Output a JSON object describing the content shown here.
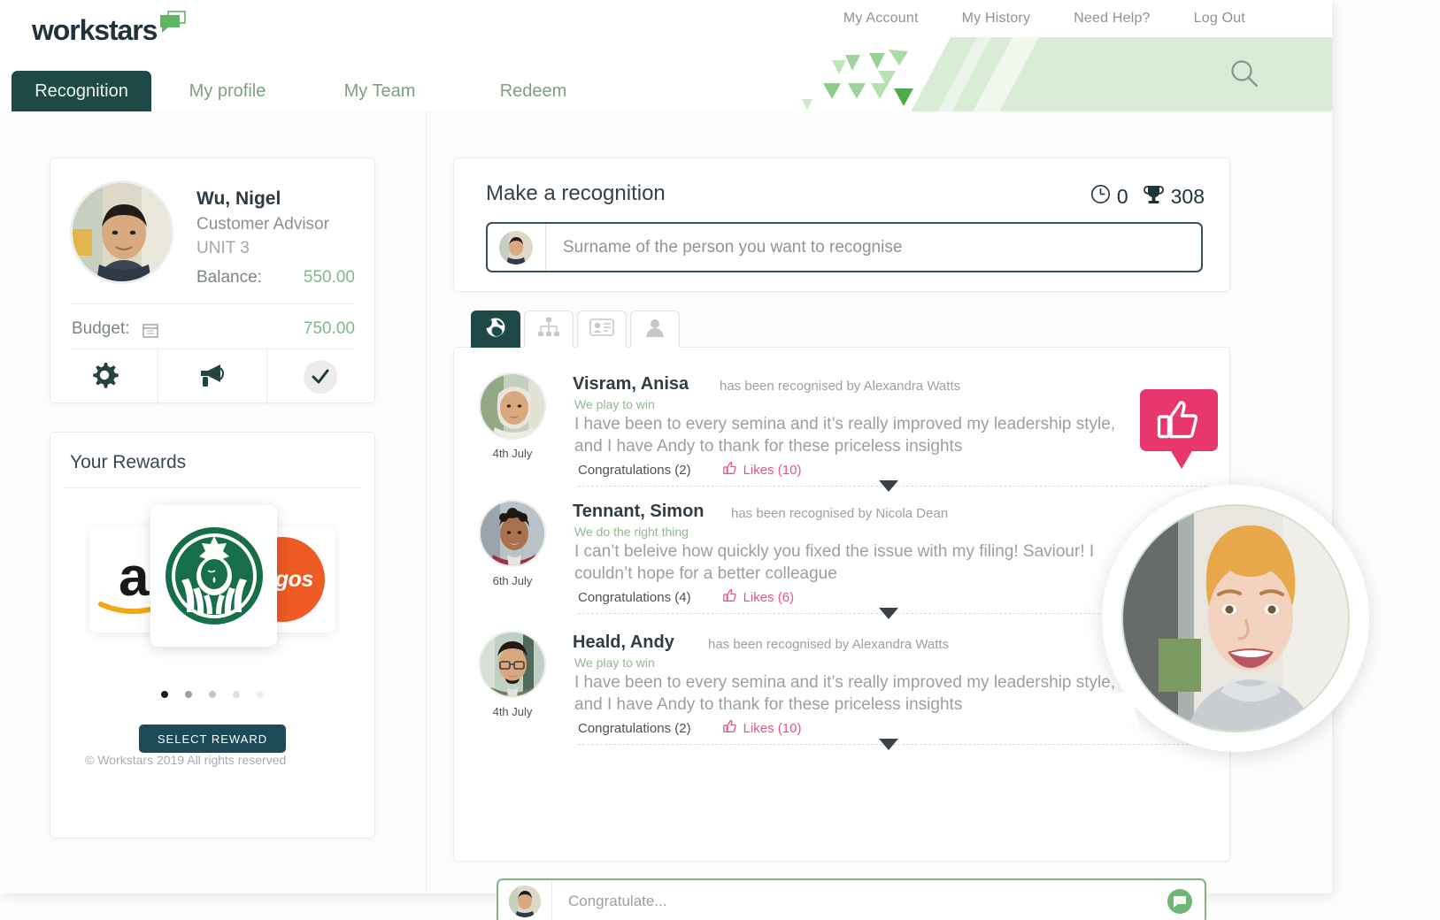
{
  "brand": {
    "logo_text": "workstars",
    "logo_icon": "speech-bubble-icon",
    "accent_dark": "#1d4a46",
    "accent_green": "#7fb98a",
    "accent_pink": "#e8366e",
    "accent_orange": "#ee5b25"
  },
  "utility_nav": [
    {
      "label": "My Account"
    },
    {
      "label": "My History"
    },
    {
      "label": "Need Help?"
    },
    {
      "label": "Log Out"
    }
  ],
  "main_nav": [
    {
      "label": "Recognition",
      "active": true
    },
    {
      "label": "My profile",
      "active": false
    },
    {
      "label": "My Team",
      "active": false
    },
    {
      "label": "Redeem",
      "active": false
    }
  ],
  "search": {
    "icon": "search-icon"
  },
  "profile": {
    "name": "Wu, Nigel",
    "role": "Customer Advisor",
    "unit": "UNIT 3",
    "balance_label": "Balance:",
    "balance_value": "550.00",
    "budget_label": "Budget:",
    "budget_icon": "calendar-icon",
    "budget_value": "750.00",
    "actions": [
      {
        "icon": "gear-icon",
        "name": "settings"
      },
      {
        "icon": "megaphone-icon",
        "name": "announcements"
      },
      {
        "icon": "check-icon",
        "name": "approvals"
      }
    ]
  },
  "rewards": {
    "title": "Your Rewards",
    "tiles": [
      {
        "brand": "Amazon",
        "icon": "amazon-logo"
      },
      {
        "brand": "Starbucks",
        "icon": "starbucks-logo"
      },
      {
        "brand": "Argos",
        "icon": "argos-logo",
        "text": "Argos"
      }
    ],
    "dots": 5,
    "active_dot": 0,
    "select_label": "SELECT REWARD"
  },
  "copyright": {
    "symbol": "©",
    "text": "Workstars 2019 All rights reserved"
  },
  "recognition": {
    "title": "Make a recognition",
    "counters": [
      {
        "icon": "clock-icon",
        "value": "0"
      },
      {
        "icon": "trophy-icon",
        "value": "308"
      }
    ],
    "input_placeholder": "Surname of the person you want to recognise",
    "input_value": ""
  },
  "feed_tabs": [
    {
      "icon": "globe-icon",
      "name": "company-wide",
      "active": true
    },
    {
      "icon": "org-chart-icon",
      "name": "department",
      "active": false
    },
    {
      "icon": "id-card-icon",
      "name": "my-recognitions",
      "active": false
    },
    {
      "icon": "person-icon",
      "name": "personal",
      "active": false
    }
  ],
  "feed": [
    {
      "name": "Visram, Anisa",
      "by": "has been recognised by Alexandra Watts",
      "value": "We play to win",
      "message": "I have been to every semina and it’s really improved my leadership style, and I have Andy to thank for these priceless insights",
      "date": "4th July",
      "congratulations": "Congratulations (2)",
      "likes": "Likes (10)"
    },
    {
      "name": "Tennant, Simon",
      "by": "has been recognised by Nicola Dean",
      "value": "We do the right thing",
      "message": "I can’t beleive how quickly you fixed the issue with my filing! Saviour! I couldn’t hope for a better colleague",
      "date": "6th July",
      "congratulations": "Congratulations (4)",
      "likes": "Likes (6)"
    },
    {
      "name": "Heald, Andy",
      "by": "has been recognised by Alexandra Watts",
      "value": "We play to win",
      "message": "I have been to every semina and it’s really improved my leadership style, and I have Andy to thank for these priceless insights",
      "date": "4th July",
      "congratulations": "Congratulations (2)",
      "likes": "Likes (10)"
    }
  ],
  "comment_box": {
    "placeholder": "Congratulate...",
    "value": "",
    "send_icon": "chat-bubble-icon"
  },
  "overlays": {
    "thumb_bubble_icon": "thumbs-up-icon",
    "photo_bubble": "portrait-photo"
  }
}
